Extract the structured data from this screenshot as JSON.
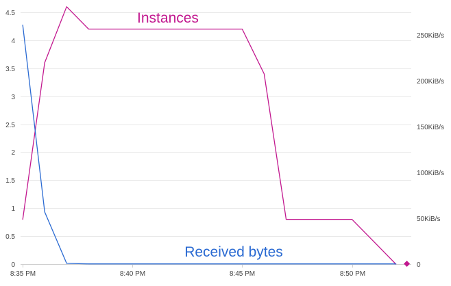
{
  "chart_data": {
    "type": "line",
    "colors": {
      "instances": "#c2188f",
      "received_bytes": "#2a6ad2"
    },
    "x_axis": {
      "unit": "minutes",
      "range": [
        -0.1,
        17.7
      ],
      "ticks": [
        {
          "value": 0,
          "label": "8:35 PM"
        },
        {
          "value": 5,
          "label": "8:40 PM"
        },
        {
          "value": 10,
          "label": "8:45 PM"
        },
        {
          "value": 15,
          "label": "8:50 PM"
        }
      ]
    },
    "y_left": {
      "range": [
        0,
        4.5
      ],
      "ticks": [
        {
          "value": 0,
          "label": "0"
        },
        {
          "value": 0.5,
          "label": "0.5"
        },
        {
          "value": 1,
          "label": "1"
        },
        {
          "value": 1.5,
          "label": "1.5"
        },
        {
          "value": 2,
          "label": "2"
        },
        {
          "value": 2.5,
          "label": "2.5"
        },
        {
          "value": 3,
          "label": "3"
        },
        {
          "value": 3.5,
          "label": "3.5"
        },
        {
          "value": 4,
          "label": "4"
        },
        {
          "value": 4.5,
          "label": "4.5"
        }
      ]
    },
    "y_right": {
      "range": [
        0,
        275
      ],
      "ticks": [
        {
          "value": 0,
          "label": "0"
        },
        {
          "value": 50,
          "label": "50KiB/s"
        },
        {
          "value": 100,
          "label": "100KiB/s"
        },
        {
          "value": 150,
          "label": "150KiB/s"
        },
        {
          "value": 200,
          "label": "200KiB/s"
        },
        {
          "value": 250,
          "label": "250KiB/s"
        }
      ]
    },
    "grid": true,
    "series": [
      {
        "name": "Instances",
        "axis": "left",
        "color": "#c2188f",
        "points": [
          [
            0,
            0.8
          ],
          [
            1,
            3.6
          ],
          [
            2,
            4.6
          ],
          [
            3,
            4.2
          ],
          [
            10,
            4.2
          ],
          [
            11,
            3.4
          ],
          [
            12,
            0.8
          ],
          [
            15,
            0.8
          ],
          [
            17,
            0.0
          ]
        ],
        "end_marker": {
          "x": 17.5,
          "y": 0.0,
          "shape": "diamond"
        }
      },
      {
        "name": "Received bytes",
        "axis": "right",
        "color": "#2a6ad2",
        "points": [
          [
            0,
            261
          ],
          [
            1,
            57
          ],
          [
            2,
            0.8
          ],
          [
            3,
            0.2
          ],
          [
            17,
            0.2
          ]
        ]
      }
    ]
  }
}
